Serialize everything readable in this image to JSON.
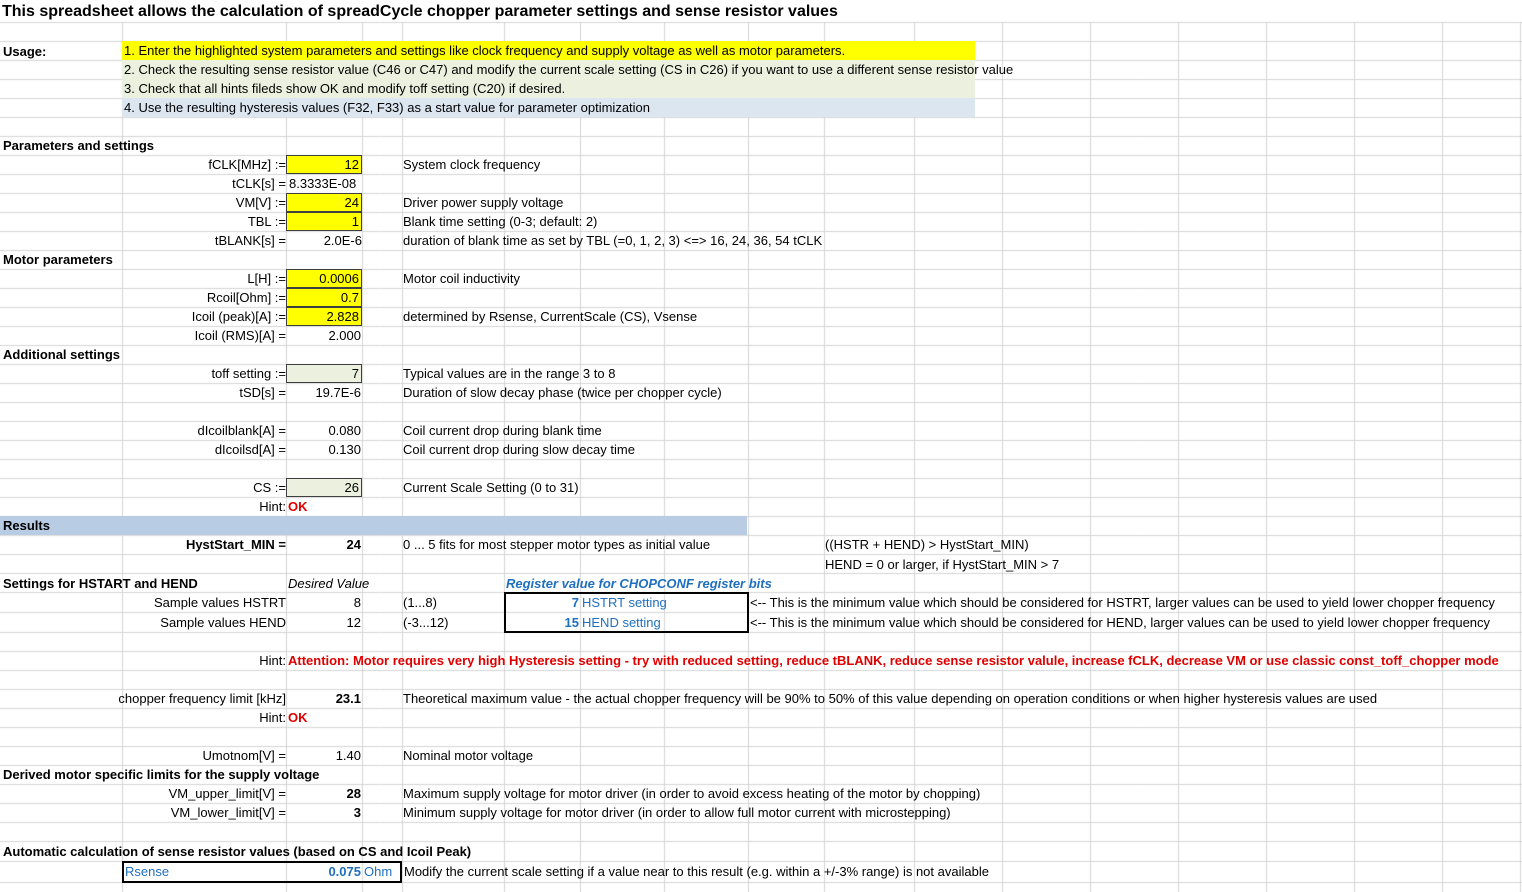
{
  "title": "This spreadsheet allows the calculation of spreadCycle chopper parameter settings and sense resistor values",
  "usage": {
    "label": "Usage:",
    "steps": [
      "1. Enter the highlighted system parameters and settings like clock frequency and supply voltage as well as motor parameters.",
      "2. Check the resulting sense resistor value (C46 or C47) and modify the current scale setting (CS in C26) if you want to use a different sense resistor value",
      "3. Check that all hints fileds show OK and modify toff setting (C20) if desired.",
      "4. Use the resulting hysteresis values (F32, F33) as a start value for parameter optimization"
    ]
  },
  "params": {
    "header": "Parameters and settings",
    "fclk": {
      "label": "fCLK[MHz] :=",
      "value": "12",
      "desc": "System clock frequency"
    },
    "tclk": {
      "label": "tCLK[s] =",
      "value": "8.3333E-08"
    },
    "vm": {
      "label": "VM[V] :=",
      "value": "24",
      "desc": "Driver power supply voltage"
    },
    "tbl": {
      "label": "TBL :=",
      "value": "1",
      "desc": "Blank time setting (0-3; default: 2)"
    },
    "tblank": {
      "label": "tBLANK[s] =",
      "value": "2.0E-6",
      "desc": "duration of blank time as set by TBL (=0, 1, 2, 3) <=> 16, 24, 36, 54 tCLK"
    }
  },
  "motor": {
    "header": "Motor parameters",
    "l": {
      "label": "L[H] :=",
      "value": "0.0006",
      "desc": "Motor coil inductivity"
    },
    "rcoil": {
      "label": "Rcoil[Ohm] :=",
      "value": "0.7"
    },
    "icoil_peak": {
      "label": "Icoil (peak)[A] :=",
      "value": "2.828",
      "desc": "determined by Rsense, CurrentScale (CS), Vsense"
    },
    "icoil_rms": {
      "label": "Icoil (RMS)[A] =",
      "value": "2.000"
    }
  },
  "additional": {
    "header": "Additional settings",
    "toff": {
      "label": "toff setting :=",
      "value": "7",
      "desc": "Typical values are in the range 3 to 8"
    },
    "tsd": {
      "label": "tSD[s] =",
      "value": "19.7E-6",
      "desc": "Duration of slow decay phase (twice per chopper cycle)"
    },
    "dblank": {
      "label": "dIcoilblank[A] =",
      "value": "0.080",
      "desc": "Coil current drop during blank time"
    },
    "dsd": {
      "label": "dIcoilsd[A] =",
      "value": "0.130",
      "desc": "Coil current drop during slow decay time"
    },
    "cs": {
      "label": "CS :=",
      "value": "26",
      "desc": "Current Scale Setting (0 to 31)"
    },
    "hint_label": "Hint:",
    "hint_value": "OK"
  },
  "results": {
    "header": "Results",
    "hyststart": {
      "label": "HystStart_MIN =",
      "value": "24",
      "desc": "0 ... 5 fits for most stepper motor types as initial value"
    },
    "note1": "((HSTR + HEND) > HystStart_MIN)",
    "note2": "HEND = 0 or larger, if HystStart_MIN  > 7",
    "settings_header": "Settings for HSTART and HEND",
    "desired_header": "Desired Value",
    "register_header": "Register value for CHOPCONF register bits",
    "hstrt": {
      "label": "Sample values HSTRT",
      "value": "8",
      "range": "(1...8)",
      "reg_value": "7",
      "reg_label": "HSTRT setting",
      "note": "<-- This is the minimum value which should be considered for HSTRT, larger values can be used to yield lower chopper frequency"
    },
    "hend": {
      "label": "Sample values HEND",
      "value": "12",
      "range": "(-3...12)",
      "reg_value": "15",
      "reg_label": "HEND setting",
      "note": "<-- This is the minimum value which should be considered for HEND, larger values can be used to yield lower chopper frequency"
    },
    "hint_label": "Hint:",
    "hint_attention": "Attention: Motor requires very high Hysteresis setting  - try with reduced setting, reduce tBLANK, reduce sense resistor valule, increase fCLK, decrease VM or use classic const_toff_chopper mode",
    "chopper": {
      "label": "chopper frequency limit [kHz]",
      "value": "23.1",
      "desc": "Theoretical maximum value - the actual chopper frequency will be 90% to 50% of this value depending on operation conditions or when higher hysteresis values are used"
    },
    "hint2_label": "Hint:",
    "hint2_value": "OK",
    "umotnom": {
      "label": "Umotnom[V] =",
      "value": "1.40",
      "desc": "Nominal motor voltage"
    },
    "derived_header": "Derived motor specific limits for the supply voltage",
    "vm_upper": {
      "label": "VM_upper_limit[V] =",
      "value": "28",
      "desc": "Maximum supply voltage for motor driver (in order to avoid excess heating of the motor by chopping)"
    },
    "vm_lower": {
      "label": "VM_lower_limit[V] =",
      "value": "3",
      "desc": "Minimum supply voltage for motor driver (in order to allow full motor current with microstepping)"
    },
    "auto_header": "Automatic calculation of sense resistor values (based on CS and Icoil Peak)",
    "rsense": {
      "label": "Rsense",
      "value": "0.075",
      "unit": "Ohm",
      "desc": "Modify the current scale setting if a value near to this result (e.g. within a +/-3% range) is not available"
    }
  },
  "colors": {
    "highlight_yellow": "#ffff00",
    "highlight_green": "#ebf1de",
    "highlight_blue": "#dce6f1",
    "hint_red": "#e00000",
    "link_blue": "#1f6fbf",
    "gridline": "#d4d4d4"
  }
}
